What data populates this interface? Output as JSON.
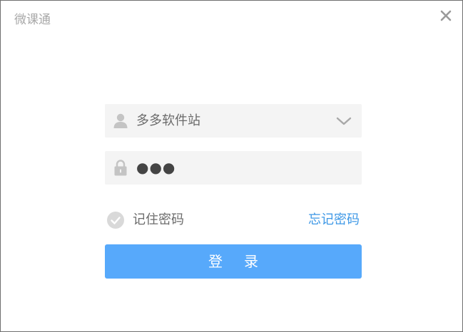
{
  "window": {
    "title": "微课通"
  },
  "login": {
    "username": "多多软件站",
    "password_masked": "●●●",
    "remember_label": "记住密码",
    "remember_checked": false,
    "forgot_label": "忘记密码",
    "submit_label": "登录"
  },
  "colors": {
    "accent": "#57a9fb",
    "link": "#3e98e6",
    "field_bg": "#f4f4f4",
    "icon": "#c4c4c4"
  },
  "icons": {
    "close": "close-icon",
    "user": "user-icon",
    "lock": "lock-icon",
    "dropdown": "chevron-down-icon",
    "check": "check-circle-icon"
  }
}
